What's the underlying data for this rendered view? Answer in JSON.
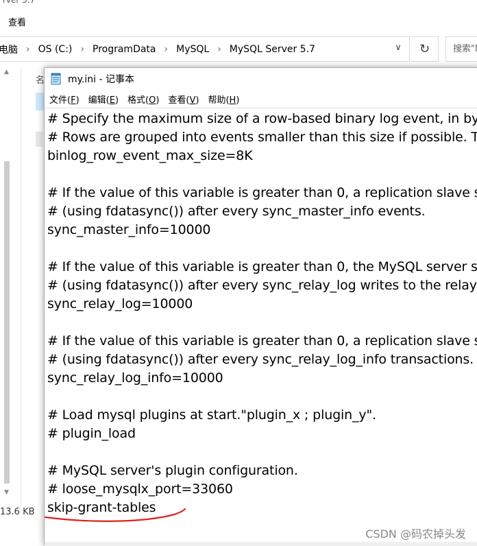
{
  "explorer": {
    "window_title_fragment": "rver 5.7",
    "ribbon_tab": "查看",
    "breadcrumb": [
      "电脑",
      "OS (C:)",
      "ProgramData",
      "MySQL",
      "MySQL Server 5.7"
    ],
    "search_placeholder": "搜索\"M",
    "column_header": "名",
    "file_size": "13.6 KB"
  },
  "notepad": {
    "title": "my.ini - 记事本",
    "menu": [
      {
        "label": "文件(",
        "key": "F",
        "end": ")"
      },
      {
        "label": "编辑(",
        "key": "E",
        "end": ")"
      },
      {
        "label": "格式(",
        "key": "O",
        "end": ")"
      },
      {
        "label": "查看(",
        "key": "V",
        "end": ")"
      },
      {
        "label": "帮助(",
        "key": "H",
        "end": ")"
      }
    ],
    "lines": [
      "# Specify the maximum size of a row-based binary log event, in by",
      "# Rows are grouped into events smaller than this size if possible. T",
      "binlog_row_event_max_size=8K",
      "",
      "# If the value of this variable is greater than 0, a replication slave sy",
      "# (using fdatasync()) after every sync_master_info events.",
      "sync_master_info=10000",
      "",
      "# If the value of this variable is greater than 0, the MySQL server sy",
      "# (using fdatasync()) after every sync_relay_log writes to the relay",
      "sync_relay_log=10000",
      "",
      "# If the value of this variable is greater than 0, a replication slave sy",
      "# (using fdatasync()) after every sync_relay_log_info transactions.",
      "sync_relay_log_info=10000",
      "",
      "# Load mysql plugins at start.\"plugin_x ; plugin_y\".",
      "# plugin_load",
      "",
      "# MySQL server's plugin configuration.",
      "# loose_mysqlx_port=33060",
      "skip-grant-tables"
    ]
  },
  "annotation": {
    "underline_color": "#e02020"
  },
  "watermark": "CSDN @码农掉头发"
}
